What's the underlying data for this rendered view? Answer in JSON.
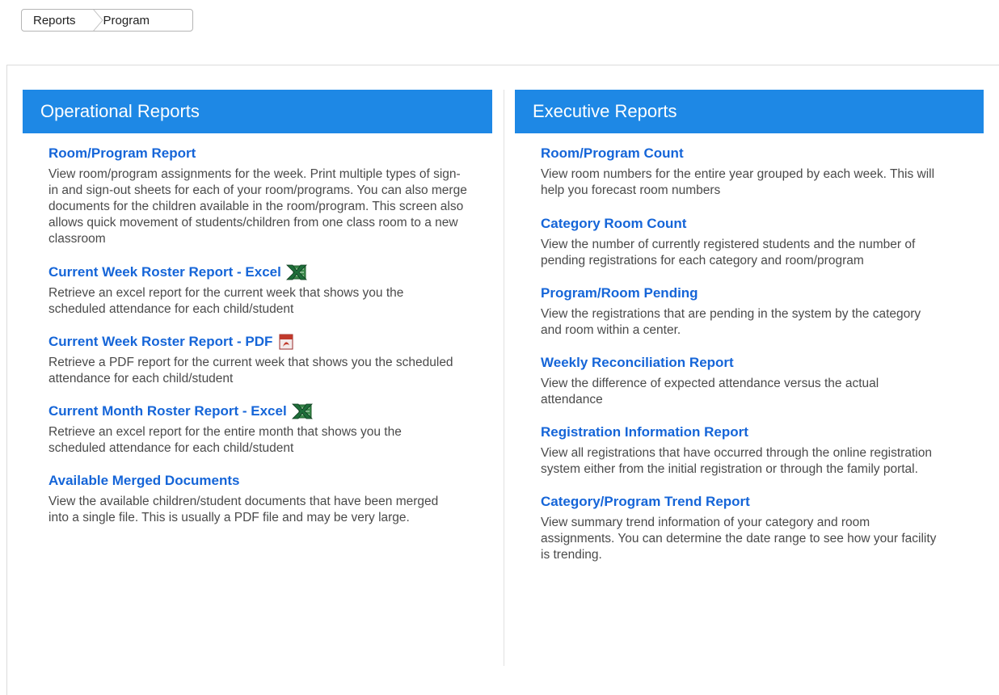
{
  "breadcrumb": {
    "items": [
      "Reports",
      "Program"
    ]
  },
  "operational": {
    "title": "Operational Reports",
    "items": [
      {
        "title": "Room/Program Report",
        "desc": "View room/program assignments for the week. Print multiple types of sign-in and sign-out sheets for each of your room/programs. You can also merge documents for the children available in the room/program. This screen also allows quick movement of students/children from one class room to a new classroom",
        "icon": ""
      },
      {
        "title": "Current Week Roster Report - Excel",
        "desc": "Retrieve an excel report for the current week that shows you the scheduled attendance for each child/student",
        "icon": "excel-icon"
      },
      {
        "title": "Current Week Roster Report - PDF",
        "desc": "Retrieve a PDF report for the current week that shows you the scheduled attendance for each child/student",
        "icon": "pdf-icon"
      },
      {
        "title": "Current Month Roster Report - Excel",
        "desc": "Retrieve an excel report for the entire month that shows you the scheduled attendance for each child/student",
        "icon": "excel-icon"
      },
      {
        "title": "Available Merged Documents",
        "desc": "View the available children/student documents that have been merged into a single file. This is usually a PDF file and may be very large.",
        "icon": ""
      }
    ]
  },
  "executive": {
    "title": "Executive Reports",
    "items": [
      {
        "title": "Room/Program Count",
        "desc": "View room numbers for the entire year grouped by each week. This will help you forecast room numbers"
      },
      {
        "title": "Category Room Count",
        "desc": "View the number of currently registered students and the number of pending registrations for each category and room/program"
      },
      {
        "title": "Program/Room Pending",
        "desc": "View the registrations that are pending in the system by the category and room within a center."
      },
      {
        "title": "Weekly Reconciliation Report",
        "desc": "View the difference of expected attendance versus the actual attendance"
      },
      {
        "title": "Registration Information Report",
        "desc": "View all registrations that have occurred through the online registration system either from the initial registration or through the family portal."
      },
      {
        "title": "Category/Program Trend Report",
        "desc": "View summary trend information of your category and room assignments. You can determine the date range to see how your facility is trending."
      }
    ]
  },
  "colors": {
    "header_bg": "#1e88e5",
    "link": "#1565d8"
  }
}
